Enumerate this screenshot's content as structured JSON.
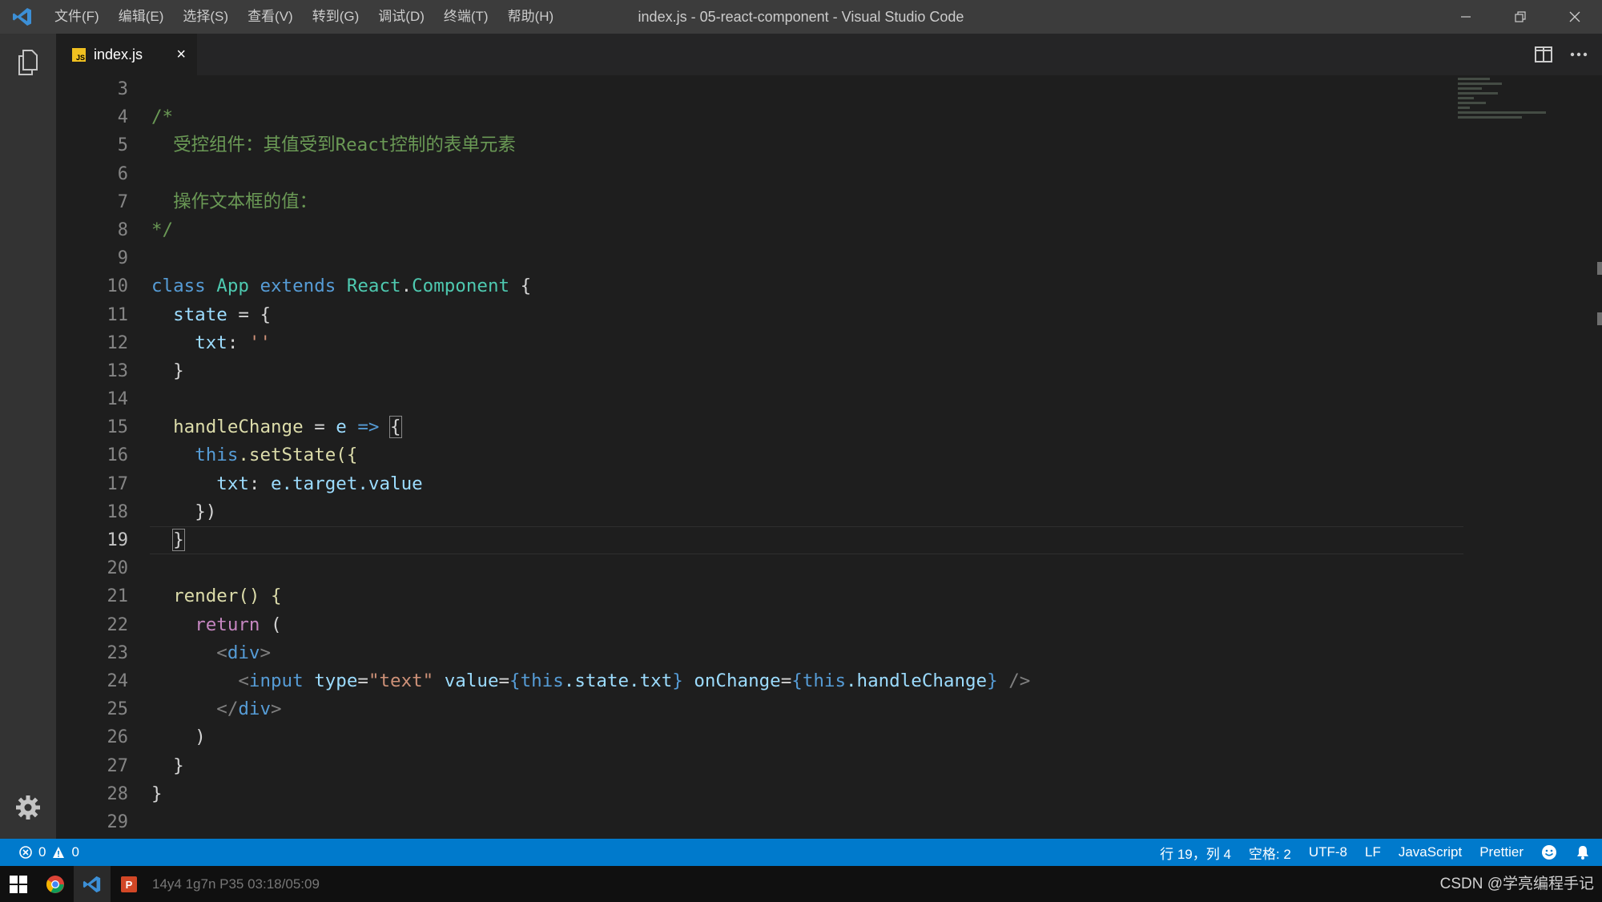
{
  "titlebar": {
    "menu": [
      "文件(F)",
      "编辑(E)",
      "选择(S)",
      "查看(V)",
      "转到(G)",
      "调试(D)",
      "终端(T)",
      "帮助(H)"
    ],
    "title": "index.js - 05-react-component - Visual Studio Code"
  },
  "tab": {
    "label": "index.js",
    "close": "×"
  },
  "editor": {
    "line_numbers": [
      "3",
      "4",
      "5",
      "6",
      "7",
      "8",
      "9",
      "10",
      "11",
      "12",
      "13",
      "14",
      "15",
      "16",
      "17",
      "18",
      "19",
      "20",
      "21",
      "22",
      "23",
      "24",
      "25",
      "26",
      "27",
      "28",
      "29"
    ],
    "active_line": "19",
    "code": {
      "l4": "/*",
      "l5": "  受控组件：其值受到React控制的表单元素",
      "l7": "  操作文本框的值：",
      "l8": "*/",
      "l10_class": "class",
      "l10_app": "App",
      "l10_extends": "extends",
      "l10_react": "React",
      "l10_dot": ".",
      "l10_component": "Component",
      "l10_brace": " {",
      "l11": "state",
      "l11_rest": " = {",
      "l12_txt": "txt",
      "l12_colon": ": ",
      "l12_str": "''",
      "l13": "}",
      "l15_fn": "handleChange",
      "l15_eq": " = ",
      "l15_e": "e",
      "l15_arrow": "=>",
      "l15_brace": "{",
      "l16_this": "this",
      "l16_rest": ".setState({",
      "l17_txt": "txt",
      "l17_colon": ": ",
      "l17_val": "e.target.value",
      "l18": "})",
      "l19": "}",
      "l21": "render() {",
      "l22_return": "return",
      "l22_paren": " (",
      "l23_open": "<",
      "l23_tag": "div",
      "l23_close": ">",
      "l24_open": "<",
      "l24_tag": "input",
      "l24_attr1": "type",
      "l24_eq1": "=",
      "l24_val1": "\"text\"",
      "l24_attr2": "value",
      "l24_eq2": "=",
      "l24_b1": "{",
      "l24_this1": "this",
      "l24_expr1": ".state.txt",
      "l24_b2": "}",
      "l24_attr3": "onChange",
      "l24_eq3": "=",
      "l24_b3": "{",
      "l24_this2": "this",
      "l24_expr2": ".handleChange",
      "l24_b4": "}",
      "l24_end": "/>",
      "l25_open": "</",
      "l25_tag": "div",
      "l25_close": ">",
      "l26": ")",
      "l27": "}",
      "l28": "}"
    }
  },
  "statusbar": {
    "errors": "0",
    "warnings": "0",
    "position": "行 19，列 4",
    "spaces": "空格: 2",
    "encoding": "UTF-8",
    "eol": "LF",
    "language": "JavaScript",
    "formatter": "Prettier"
  },
  "taskbar": {
    "recording_text": "14y4 1g7n P35 03:18/05:09",
    "watermark": "CSDN @学亮编程手记"
  },
  "colors": {
    "accent": "#007acc",
    "comment": "#6a9955",
    "keyword": "#569cd6",
    "class": "#4ec9b0",
    "string": "#ce9178",
    "variable": "#9cdcfe"
  }
}
